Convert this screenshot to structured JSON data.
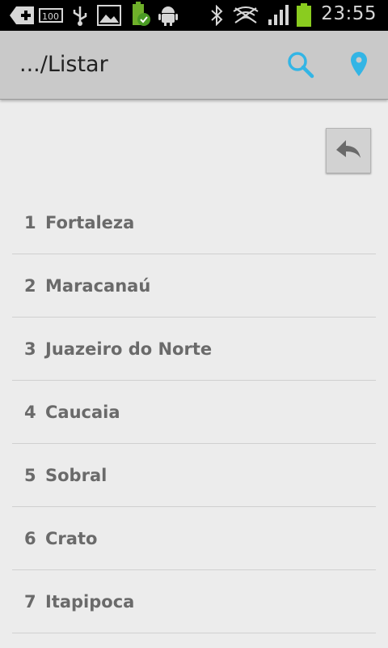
{
  "status_bar": {
    "time": "23:55",
    "icons": [
      "add-notification-icon",
      "battery-100-icon",
      "usb-icon",
      "gallery-icon",
      "battery-ok-icon",
      "android-icon",
      "bluetooth-icon",
      "wifi-off-icon",
      "signal-icon",
      "battery-icon"
    ]
  },
  "action_bar": {
    "title": ".../Listar",
    "actions": [
      "search-icon",
      "location-pin-icon"
    ],
    "accent": "#33b5e5"
  },
  "back_button": {
    "icon": "reply-icon"
  },
  "cities": [
    {
      "num": "1",
      "name": "Fortaleza"
    },
    {
      "num": "2",
      "name": "Maracanaú"
    },
    {
      "num": "3",
      "name": "Juazeiro do Norte"
    },
    {
      "num": "4",
      "name": "Caucaia"
    },
    {
      "num": "5",
      "name": "Sobral"
    },
    {
      "num": "6",
      "name": "Crato"
    },
    {
      "num": "7",
      "name": "Itapipoca"
    }
  ]
}
